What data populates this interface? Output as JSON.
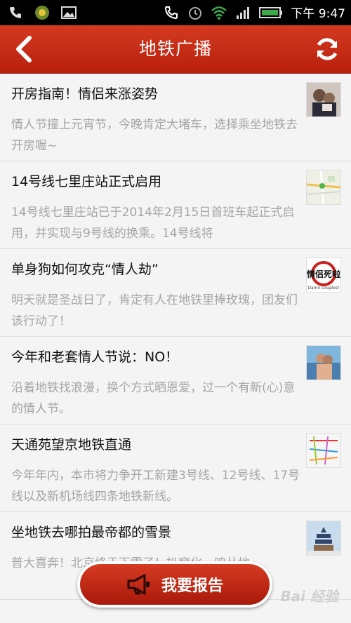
{
  "status_bar": {
    "time": "下午 9:47",
    "icons": [
      "phone-icon",
      "app-icon",
      "image-icon",
      "call-icon",
      "alarm-icon",
      "wifi-icon",
      "signal-icon",
      "battery-icon"
    ]
  },
  "header": {
    "title": "地铁广播",
    "back_icon": "chevron-left-icon",
    "refresh_icon": "refresh-icon",
    "color": "#c52c16"
  },
  "news": [
    {
      "title": "开房指南！情侣来涨姿势",
      "summary": "情人节撞上元宵节，今晚肯定大堵车，选择乘坐地铁去开房喔~",
      "thumb": "couple-photo"
    },
    {
      "title": "14号线七里庄站正式启用",
      "summary": "14号线七里庄站已于2014年2月15日首班车起正式启用，并实现与9号线的换乘。14号线将",
      "thumb": "map-thumbnail"
    },
    {
      "title": "单身狗如何攻克“情人劫”",
      "summary": "明天就是圣战日了，肯定有人在地铁里捧玫瑰，团友们该行动了！",
      "thumb": "poster-thumbnail",
      "thumb_text": "情侣死啦",
      "thumb_subtext": "Damn couples!"
    },
    {
      "title": "今年和老套情人节说：NO！",
      "summary": "沿着地铁找浪漫，换个方式晒恩爱，过一个有新(心)意的情人节。",
      "thumb": "beach-couple-photo"
    },
    {
      "title": "天通苑望京地铁直通",
      "summary": "今年年内，本市将力争开工新建3号线、12号线、17号线以及新机场线四条地铁新线。",
      "thumb": "subway-map-thumbnail"
    },
    {
      "title": "坐地铁去哪拍最帝都的雪景",
      "summary": "普大喜奔！北京终于下雪了！扒窝化，咱丛地",
      "thumb": "temple-photo"
    }
  ],
  "report_button": {
    "label": "我要报告",
    "icon": "megaphone-icon"
  },
  "watermark": "Bai 经验"
}
